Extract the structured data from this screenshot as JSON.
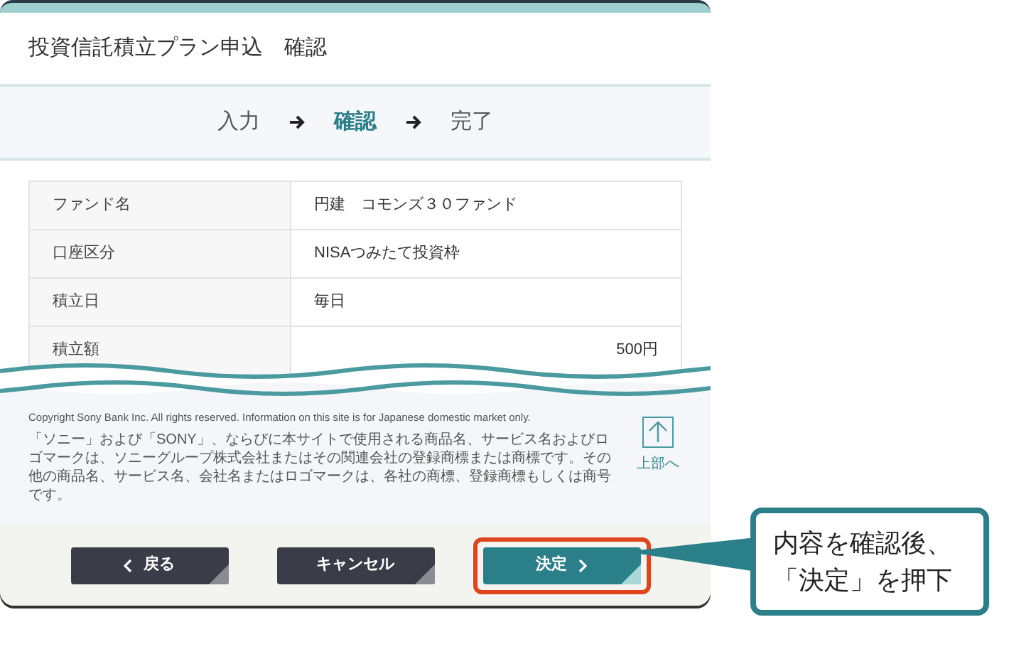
{
  "page_title": "投資信託積立プラン申込　確認",
  "steps": [
    {
      "label": "入力",
      "selected": false
    },
    {
      "label": "確認",
      "selected": true
    },
    {
      "label": "完了",
      "selected": false
    }
  ],
  "table": {
    "rows": [
      {
        "label": "ファンド名",
        "value": "円建　コモンズ３０ファンド",
        "kind": "text"
      },
      {
        "label": "口座区分",
        "value": "NISAつみたて投資枠",
        "kind": "text"
      },
      {
        "label": "積立日",
        "value": "毎日",
        "kind": "text"
      },
      {
        "label": "積立額",
        "value": "500円",
        "kind": "amount"
      }
    ]
  },
  "footer": {
    "copyright": "Copyright Sony Bank Inc. All rights reserved. Information on this site is for Japanese domestic market only.",
    "notice": "「ソニー」および「SONY」、ならびに本サイトで使用される商品名、サービス名およびロゴマークは、ソニーグループ株式会社またはその関連会社の登録商標または商標です。その他の商品名、サービス名、会社名またはロゴマークは、各社の商標、登録商標もしくは商号です。",
    "to_top": "上部へ"
  },
  "buttons": [
    {
      "label": "戻る",
      "kind": "back",
      "highlighted": false
    },
    {
      "label": "キャンセル",
      "kind": "cancel",
      "highlighted": false
    },
    {
      "label": "決定",
      "kind": "next",
      "highlighted": true
    }
  ],
  "callout": {
    "lines": [
      "内容を確認後、",
      "「決定」を押下"
    ]
  }
}
